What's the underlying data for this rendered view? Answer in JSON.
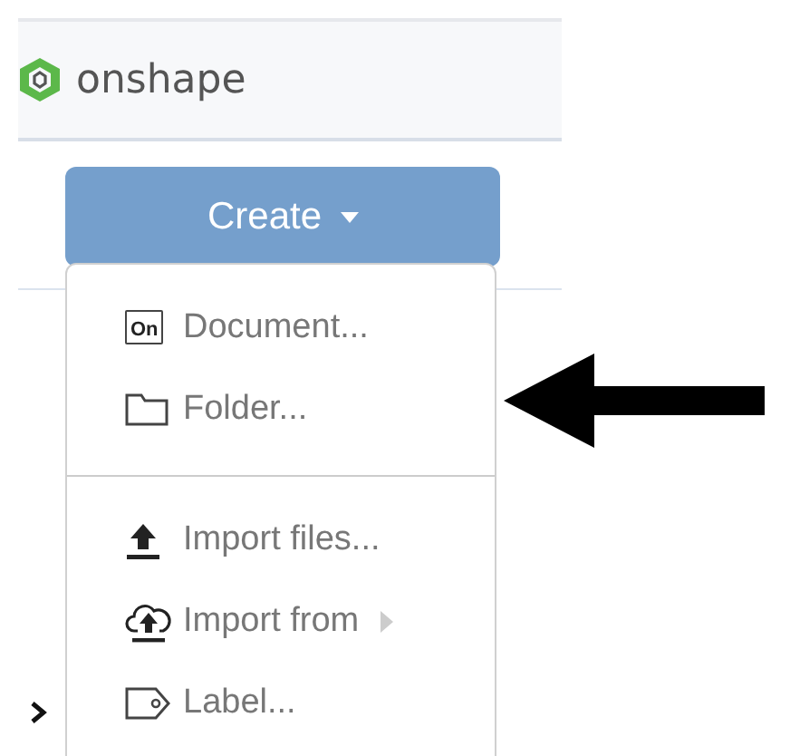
{
  "header": {
    "logo_text": "onshape"
  },
  "create_button": {
    "label": "Create"
  },
  "menu": {
    "items": [
      {
        "kind": "document",
        "label": "Document...",
        "icon_text": "On",
        "submenu": false
      },
      {
        "kind": "folder",
        "label": "Folder...",
        "submenu": false
      },
      {
        "kind": "divider"
      },
      {
        "kind": "import",
        "label": "Import files...",
        "submenu": false
      },
      {
        "kind": "cloud",
        "label": "Import from",
        "submenu": true
      },
      {
        "kind": "label",
        "label": "Label...",
        "submenu": false
      }
    ]
  },
  "annotation": {
    "kind": "arrow"
  }
}
